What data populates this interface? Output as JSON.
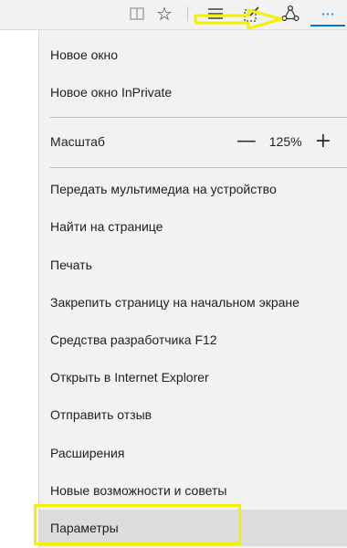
{
  "toolbar": {
    "icons": [
      "reading-view-icon",
      "favorites-star-icon",
      "hub-icon",
      "web-note-icon",
      "share-icon",
      "more-icon"
    ],
    "more_label": "···"
  },
  "menu": {
    "items": [
      {
        "label": "Новое окно"
      },
      {
        "label": "Новое окно InPrivate"
      },
      {
        "label": "Масштаб"
      },
      {
        "label": "Передать мультимедиа на устройство"
      },
      {
        "label": "Найти на странице"
      },
      {
        "label": "Печать"
      },
      {
        "label": "Закрепить страницу на начальном экране"
      },
      {
        "label": "Средства разработчика F12"
      },
      {
        "label": "Открыть в Internet Explorer"
      },
      {
        "label": "Отправить отзыв"
      },
      {
        "label": "Расширения"
      },
      {
        "label": "Новые возможности и советы"
      },
      {
        "label": "Параметры"
      }
    ],
    "zoom": {
      "minus": "—",
      "value": "125%",
      "plus": "+"
    }
  },
  "highlight_color": "#f5f000"
}
